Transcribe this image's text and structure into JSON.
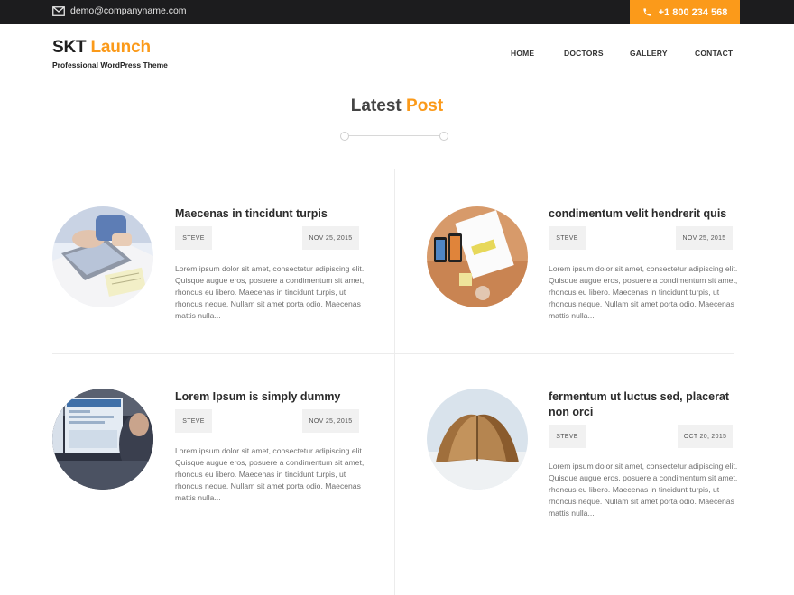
{
  "topbar": {
    "email": "demo@companyname.com",
    "phone": "+1 800 234 568"
  },
  "header": {
    "logo_dark": "SKT",
    "logo_accent": "Launch",
    "tagline": "Professional WordPress Theme"
  },
  "nav": {
    "items": [
      {
        "label": "HOME"
      },
      {
        "label": "DOCTORS"
      },
      {
        "label": "GALLERY"
      },
      {
        "label": "CONTACT"
      }
    ]
  },
  "section": {
    "title_dark": "Latest",
    "title_accent": "Post"
  },
  "posts": [
    {
      "title": "Maecenas in tincidunt turpis",
      "author": "STEVE",
      "date": "NOV 25, 2015",
      "excerpt": "Lorem ipsum dolor sit amet, consectetur adipiscing elit. Quisque augue eros, posuere a condimentum sit amet, rhoncus eu libero. Maecenas in tincidunt turpis, ut rhoncus neque. Nullam sit amet porta odio. Maecenas mattis nulla...",
      "image": "laptop-typing-photo"
    },
    {
      "title": "condimentum velit hendrerit quis",
      "author": "STEVE",
      "date": "NOV 25, 2015",
      "excerpt": "Lorem ipsum dolor sit amet, consectetur adipiscing elit. Quisque augue eros, posuere a condimentum sit amet, rhoncus eu libero. Maecenas in tincidunt turpis, ut rhoncus neque. Nullam sit amet porta odio. Maecenas mattis nulla...",
      "image": "phones-on-desk-photo"
    },
    {
      "title": "Lorem Ipsum is simply dummy",
      "author": "STEVE",
      "date": "NOV 25, 2015",
      "excerpt": "Lorem ipsum dolor sit amet, consectetur adipiscing elit. Quisque augue eros, posuere a condimentum sit amet, rhoncus eu libero. Maecenas in tincidunt turpis, ut rhoncus neque. Nullam sit amet porta odio. Maecenas mattis nulla...",
      "image": "monitor-workstation-photo"
    },
    {
      "title": "fermentum ut luctus sed, placerat non orci",
      "author": "STEVE",
      "date": "OCT 20, 2015",
      "excerpt": "Lorem ipsum dolor sit amet, consectetur adipiscing elit. Quisque augue eros, posuere a condimentum sit amet, rhoncus eu libero. Maecenas in tincidunt turpis, ut rhoncus neque. Nullam sit amet porta odio. Maecenas mattis nulla...",
      "image": "open-book-photo"
    }
  ],
  "colors": {
    "accent": "#fb9a1a",
    "topbar": "#1c1c1e",
    "meta_bg": "#f1f1f1"
  }
}
